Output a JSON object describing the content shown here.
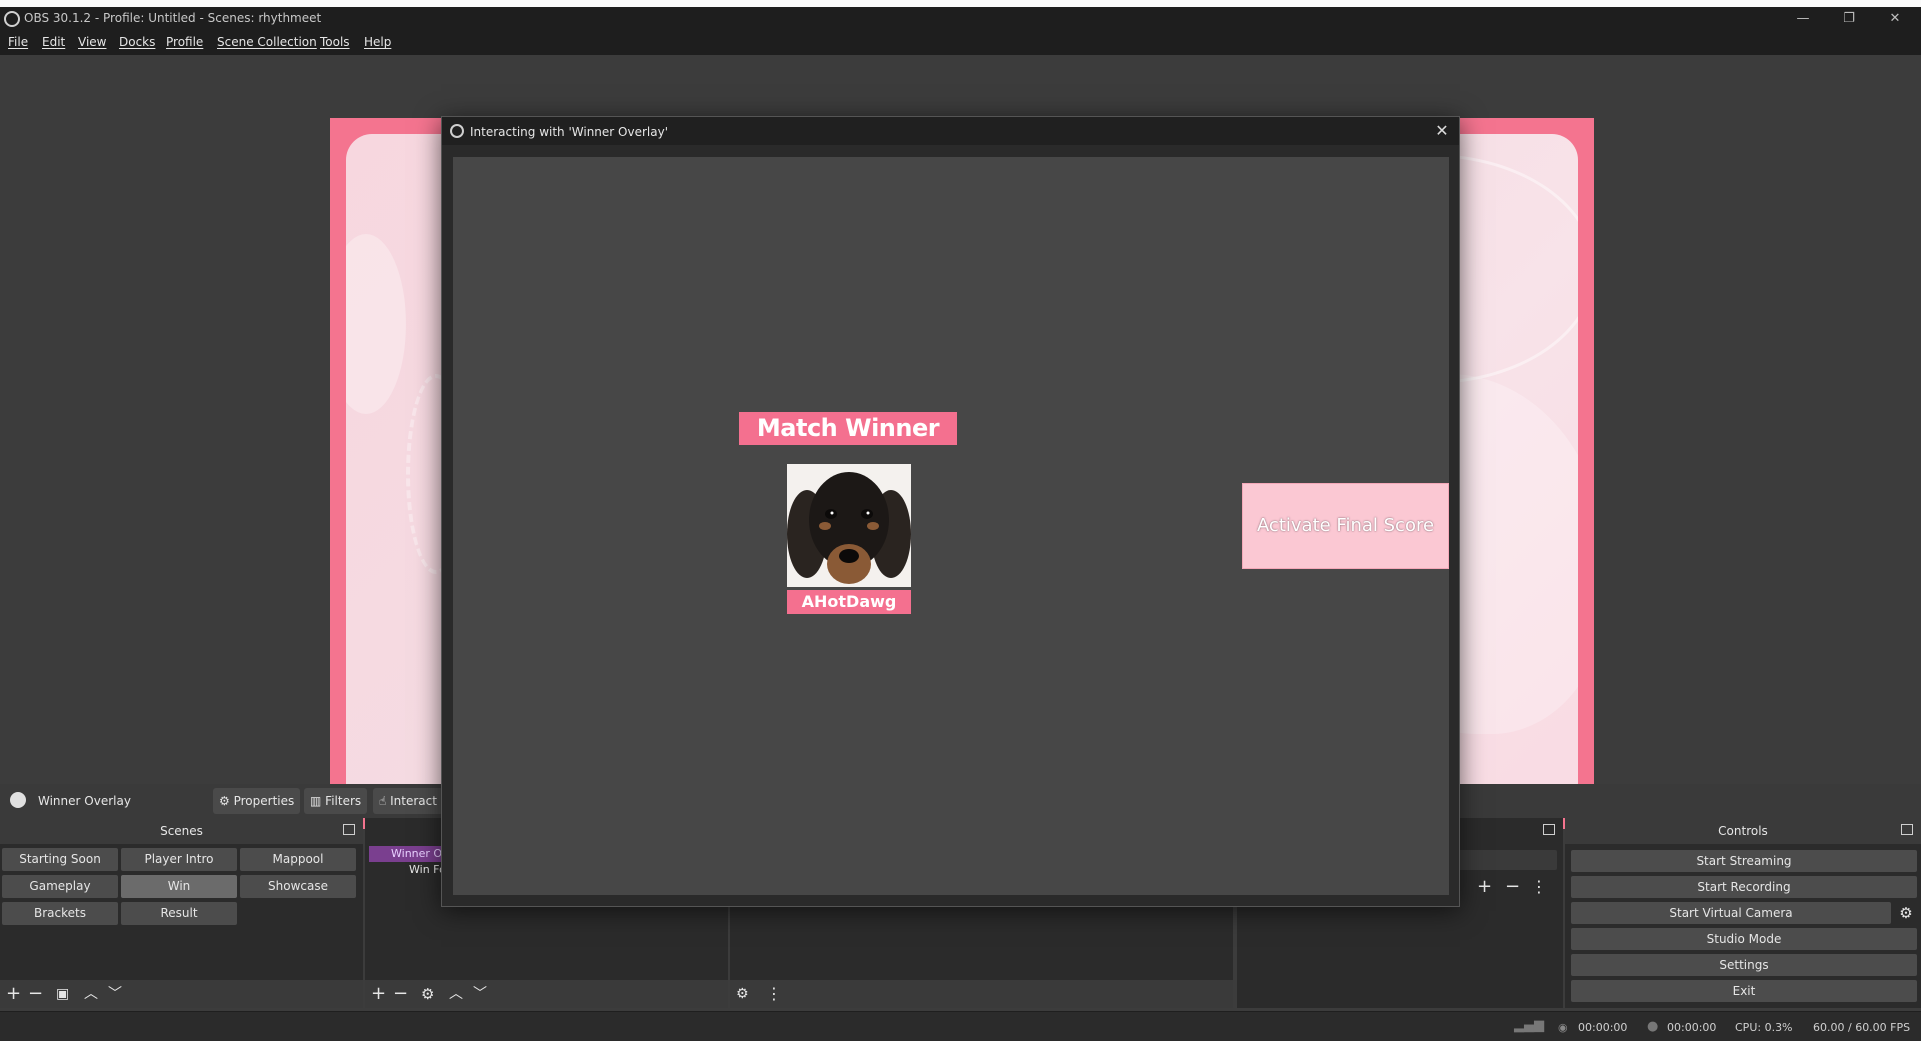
{
  "window": {
    "title": "OBS 30.1.2 - Profile: Untitled - Scenes: rhythmeet",
    "minimize_glyph": "—",
    "maximize_glyph": "❐",
    "close_glyph": "✕"
  },
  "menu": [
    "File",
    "Edit",
    "View",
    "Docks",
    "Profile",
    "Scene Collection",
    "Tools",
    "Help"
  ],
  "source_toolbar": {
    "source_name": "Winner Overlay",
    "properties_label": "Properties",
    "filters_label": "Filters",
    "interact_label": "Interact"
  },
  "scenes_dock": {
    "title": "Scenes",
    "scenes": [
      "Starting Soon",
      "Player Intro",
      "Mappool",
      "Gameplay",
      "Win",
      "Showcase",
      "Brackets",
      "Result"
    ],
    "active_scene": "Win"
  },
  "sources_dock": {
    "items": [
      "Winner O",
      "Win Fo"
    ]
  },
  "controls_dock": {
    "title": "Controls",
    "buttons": [
      "Start Streaming",
      "Start Recording",
      "Start Virtual Camera",
      "Studio Mode",
      "Settings",
      "Exit"
    ]
  },
  "status_bar": {
    "stream_time": "00:00:00",
    "record_time": "00:00:00",
    "cpu": "CPU: 0.3%",
    "fps": "60.00 / 60.00 FPS"
  },
  "dialog": {
    "title": "Interacting with 'Winner Overlay'",
    "heading": "Match Winner",
    "winner_name": "AHotDawg",
    "activate_label": "Activate Final Score"
  },
  "colors": {
    "accent_pink": "#f4708f",
    "light_pink": "#fbc8d3",
    "panel_bg": "#2b2b2b",
    "button_bg": "#4c4c4c"
  }
}
